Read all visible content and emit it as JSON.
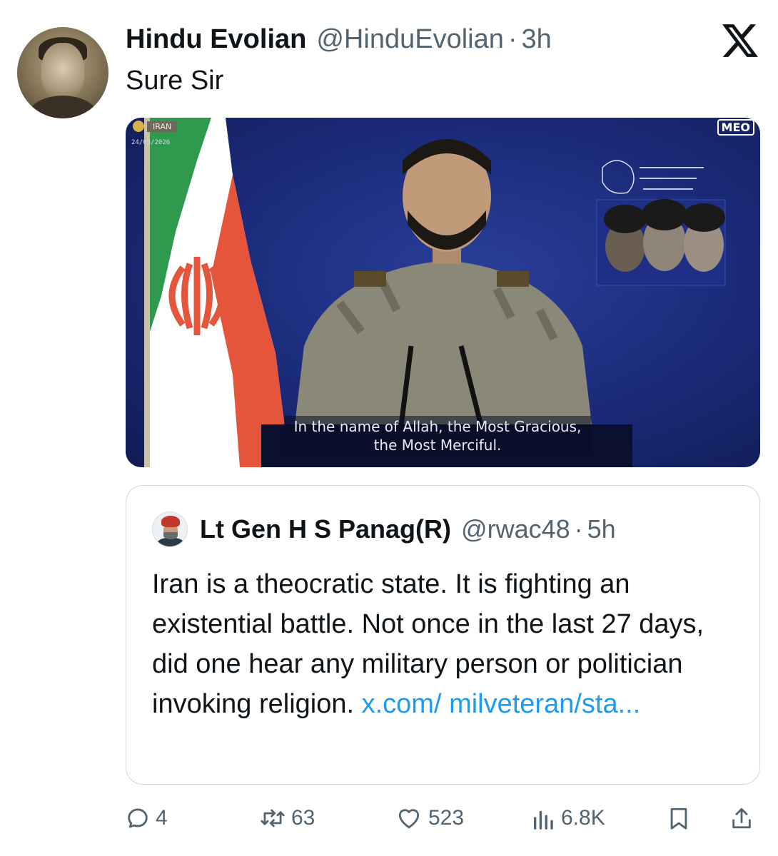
{
  "tweet": {
    "author_name": "Hindu Evolian",
    "author_handle": "@HinduEvolian",
    "separator": "·",
    "time": "3h",
    "text": "Sure Sir"
  },
  "media": {
    "country_tag": "IRAN",
    "date_tag": "24/03/2026",
    "channel_logo": "MEO",
    "subtitle_line1": "In the name of Allah, the Most Gracious,",
    "subtitle_line2": "the Most Merciful."
  },
  "quoted_tweet": {
    "author_name": "Lt Gen H S Panag(R)",
    "author_handle": "@rwac48",
    "separator": "·",
    "time": "5h",
    "text": "Iran is a theocratic state. It is fighting an existential battle. Not once in the last 27 days, did one hear any military person or politician invoking religion. ",
    "link_text": "x.com/ milveteran/sta..."
  },
  "actions": {
    "replies": "4",
    "reposts": "63",
    "likes": "523",
    "views": "6.8K"
  },
  "icons": {
    "logo": "x-logo-icon",
    "reply": "reply-icon",
    "repost": "repost-icon",
    "like": "heart-icon",
    "views": "views-icon",
    "bookmark": "bookmark-icon",
    "share": "share-icon"
  },
  "colors": {
    "text": "#0f1419",
    "muted": "#536471",
    "link": "#1d9bf0",
    "border": "#cfd9de"
  }
}
